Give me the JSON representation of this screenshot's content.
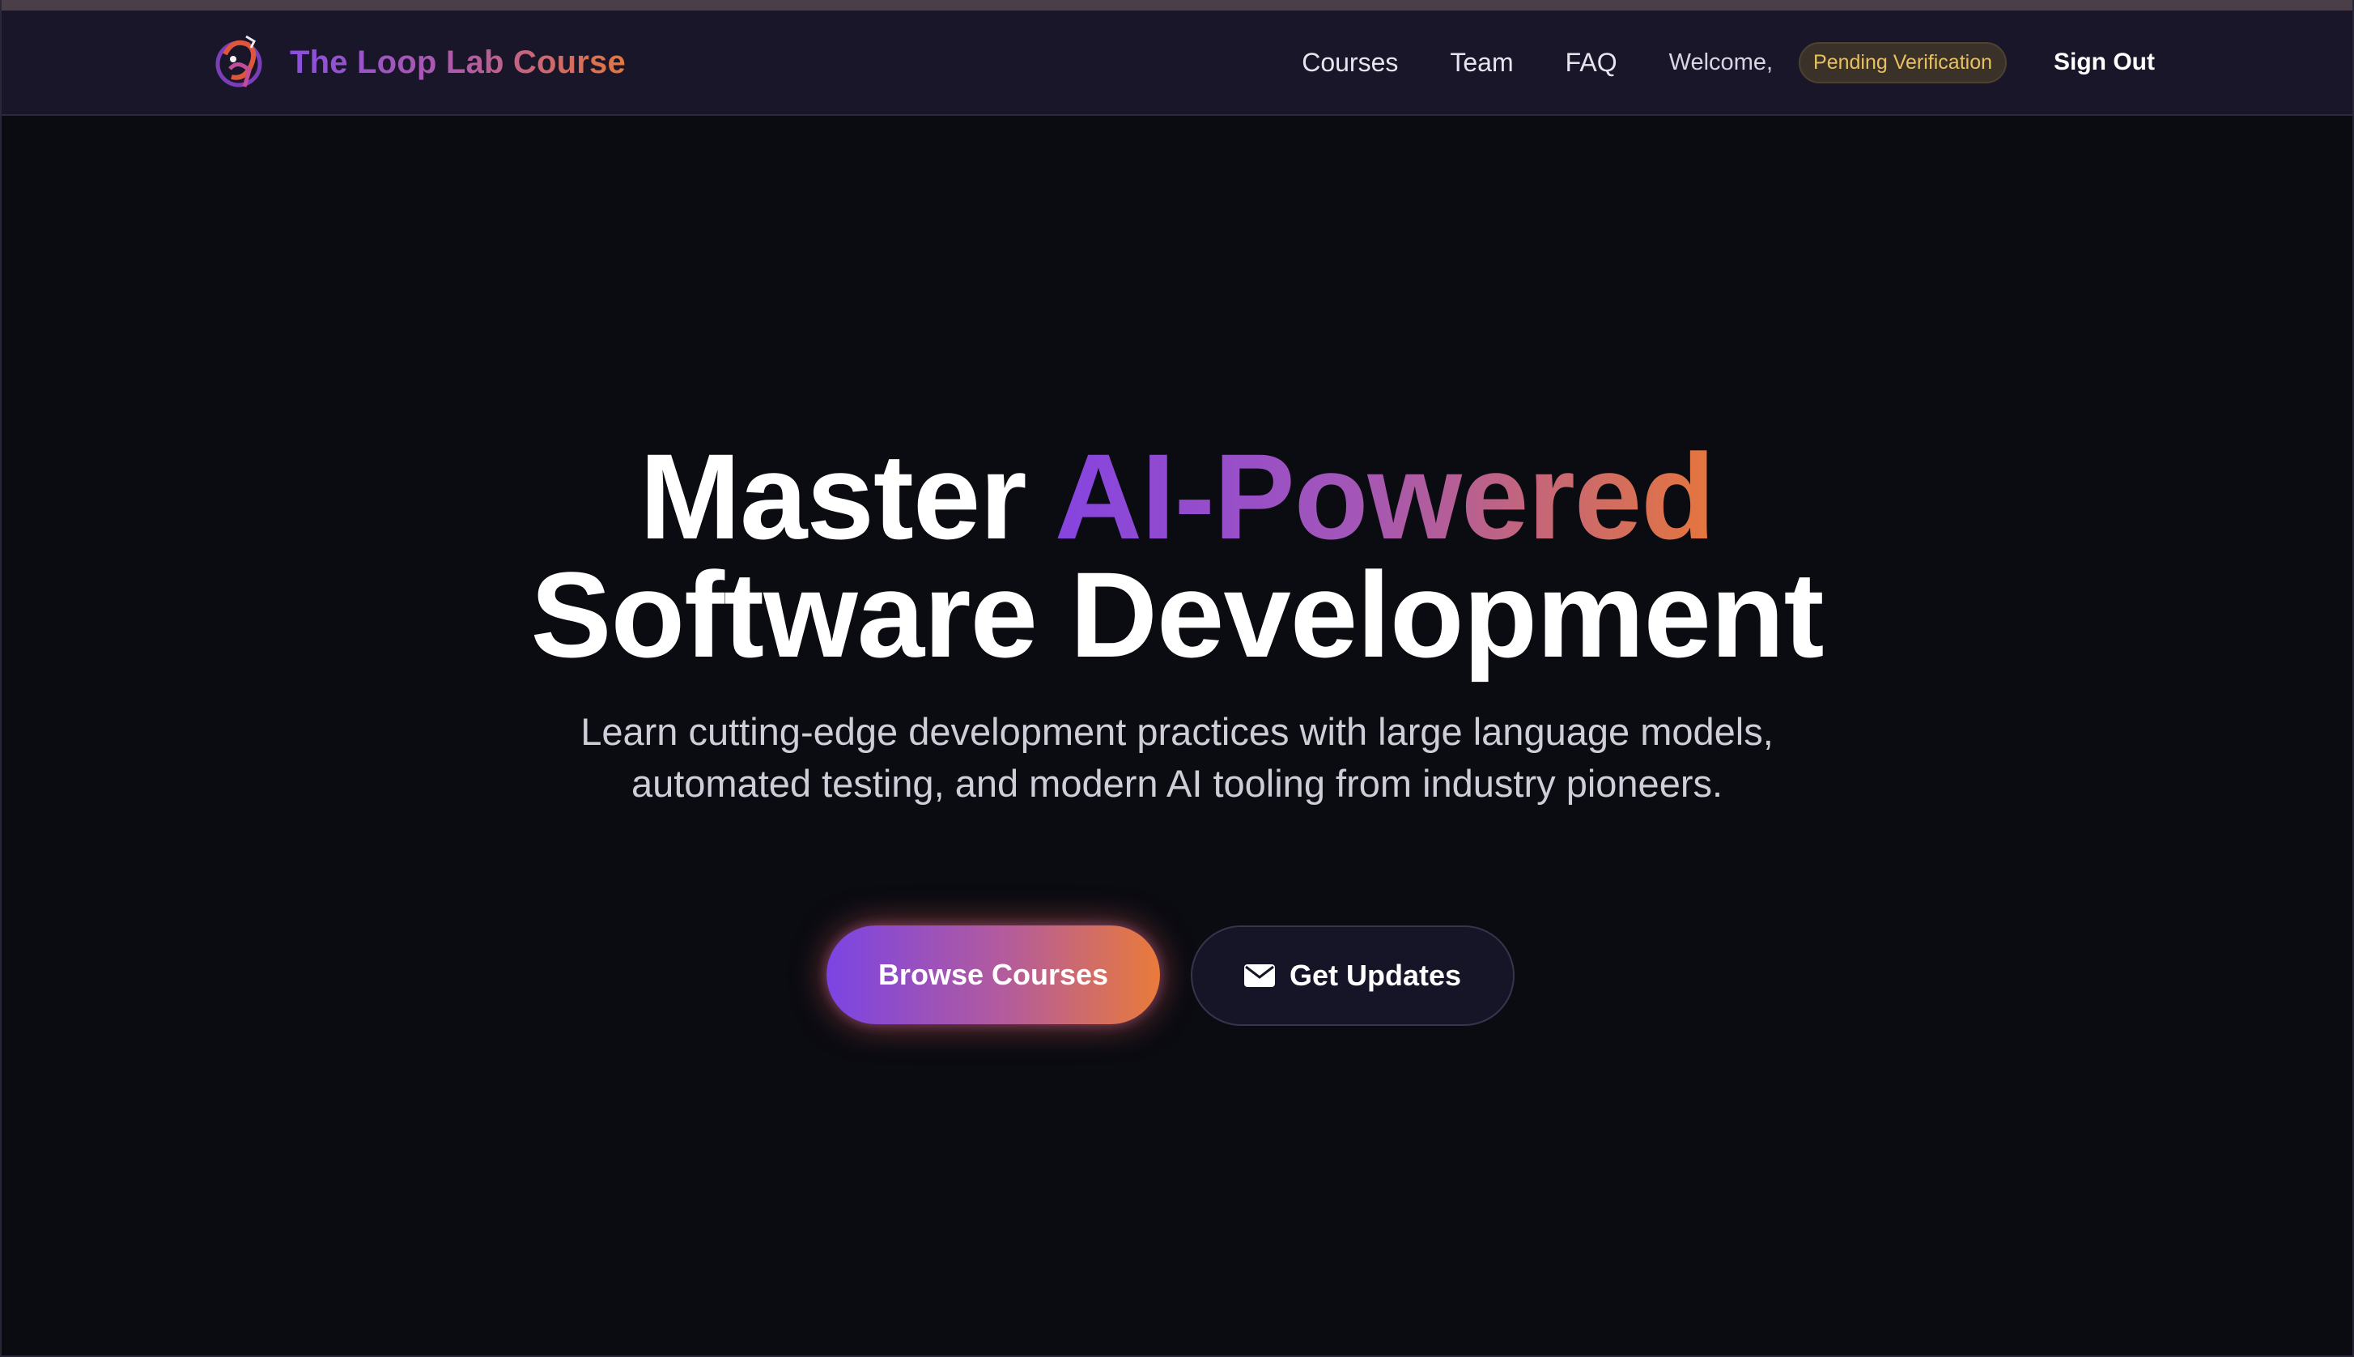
{
  "nav": {
    "brand": "The Loop Lab Course",
    "links": [
      "Courses",
      "Team",
      "FAQ"
    ],
    "welcome": "Welcome,",
    "status_badge": "Pending Verification",
    "sign_out": "Sign Out",
    "icons": {
      "logo": "loop-lab-logo-icon"
    }
  },
  "hero": {
    "headline_part1": "Master ",
    "headline_highlight": "AI-Powered",
    "headline_line2": "Software Development",
    "subtitle": "Learn cutting-edge development practices with large language models, automated testing, and modern AI tooling from industry pioneers.",
    "primary_cta": "Browse Courses",
    "secondary_cta": "Get Updates",
    "secondary_icon": "envelope-icon"
  },
  "colors": {
    "background": "#0b0b12",
    "navbar": "#181628",
    "accent_purple": "#8644e0",
    "accent_orange": "#e5763c",
    "badge_text": "#e8c063"
  }
}
